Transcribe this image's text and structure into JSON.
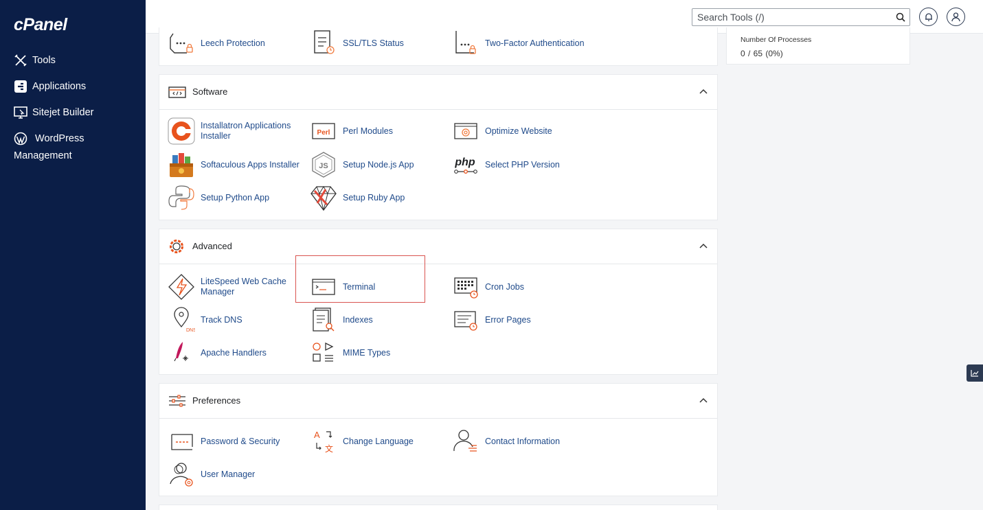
{
  "brand": "cPanel",
  "sidebar": {
    "items": [
      {
        "label": "Tools",
        "icon": "tools-icon"
      },
      {
        "label": "Applications",
        "icon": "applications-icon"
      },
      {
        "label": "Sitejet Builder",
        "icon": "sitejet-icon"
      },
      {
        "label": "WordPress Management",
        "icon": "wordpress-icon"
      }
    ]
  },
  "header": {
    "search_placeholder": "Search Tools (/)"
  },
  "stats": {
    "title": "Number Of Processes",
    "value": "0 / 65   (0%)"
  },
  "security_partial": {
    "items": [
      {
        "label": "Leech Protection",
        "icon": "leech-protection-icon"
      },
      {
        "label": "SSL/TLS Status",
        "icon": "ssl-tls-status-icon"
      },
      {
        "label": "Two-Factor Authentication",
        "icon": "two-factor-auth-icon"
      }
    ]
  },
  "software": {
    "title": "Software",
    "items": [
      {
        "label": "Installatron Applications Installer",
        "icon": "installatron-icon"
      },
      {
        "label": "Perl Modules",
        "icon": "perl-icon"
      },
      {
        "label": "Optimize Website",
        "icon": "optimize-website-icon"
      },
      {
        "label": "Softaculous Apps Installer",
        "icon": "softaculous-icon"
      },
      {
        "label": "Setup Node.js App",
        "icon": "nodejs-icon"
      },
      {
        "label": "Select PHP Version",
        "icon": "php-icon"
      },
      {
        "label": "Setup Python App",
        "icon": "python-icon"
      },
      {
        "label": "Setup Ruby App",
        "icon": "ruby-icon"
      }
    ]
  },
  "advanced": {
    "title": "Advanced",
    "items": [
      {
        "label": "LiteSpeed Web Cache Manager",
        "icon": "litespeed-icon"
      },
      {
        "label": "Terminal",
        "icon": "terminal-icon"
      },
      {
        "label": "Cron Jobs",
        "icon": "cron-jobs-icon"
      },
      {
        "label": "Track DNS",
        "icon": "track-dns-icon"
      },
      {
        "label": "Indexes",
        "icon": "indexes-icon"
      },
      {
        "label": "Error Pages",
        "icon": "error-pages-icon"
      },
      {
        "label": "Apache Handlers",
        "icon": "apache-handlers-icon"
      },
      {
        "label": "MIME Types",
        "icon": "mime-types-icon"
      }
    ]
  },
  "preferences": {
    "title": "Preferences",
    "items": [
      {
        "label": "Password & Security",
        "icon": "password-security-icon"
      },
      {
        "label": "Change Language",
        "icon": "change-language-icon"
      },
      {
        "label": "Contact Information",
        "icon": "contact-information-icon"
      },
      {
        "label": "User Manager",
        "icon": "user-manager-icon"
      }
    ]
  },
  "colors": {
    "sidebar_bg": "#0b1e47",
    "link": "#1f4a8a",
    "icon_accent": "#f07b3f",
    "highlight": "#d9534f"
  }
}
